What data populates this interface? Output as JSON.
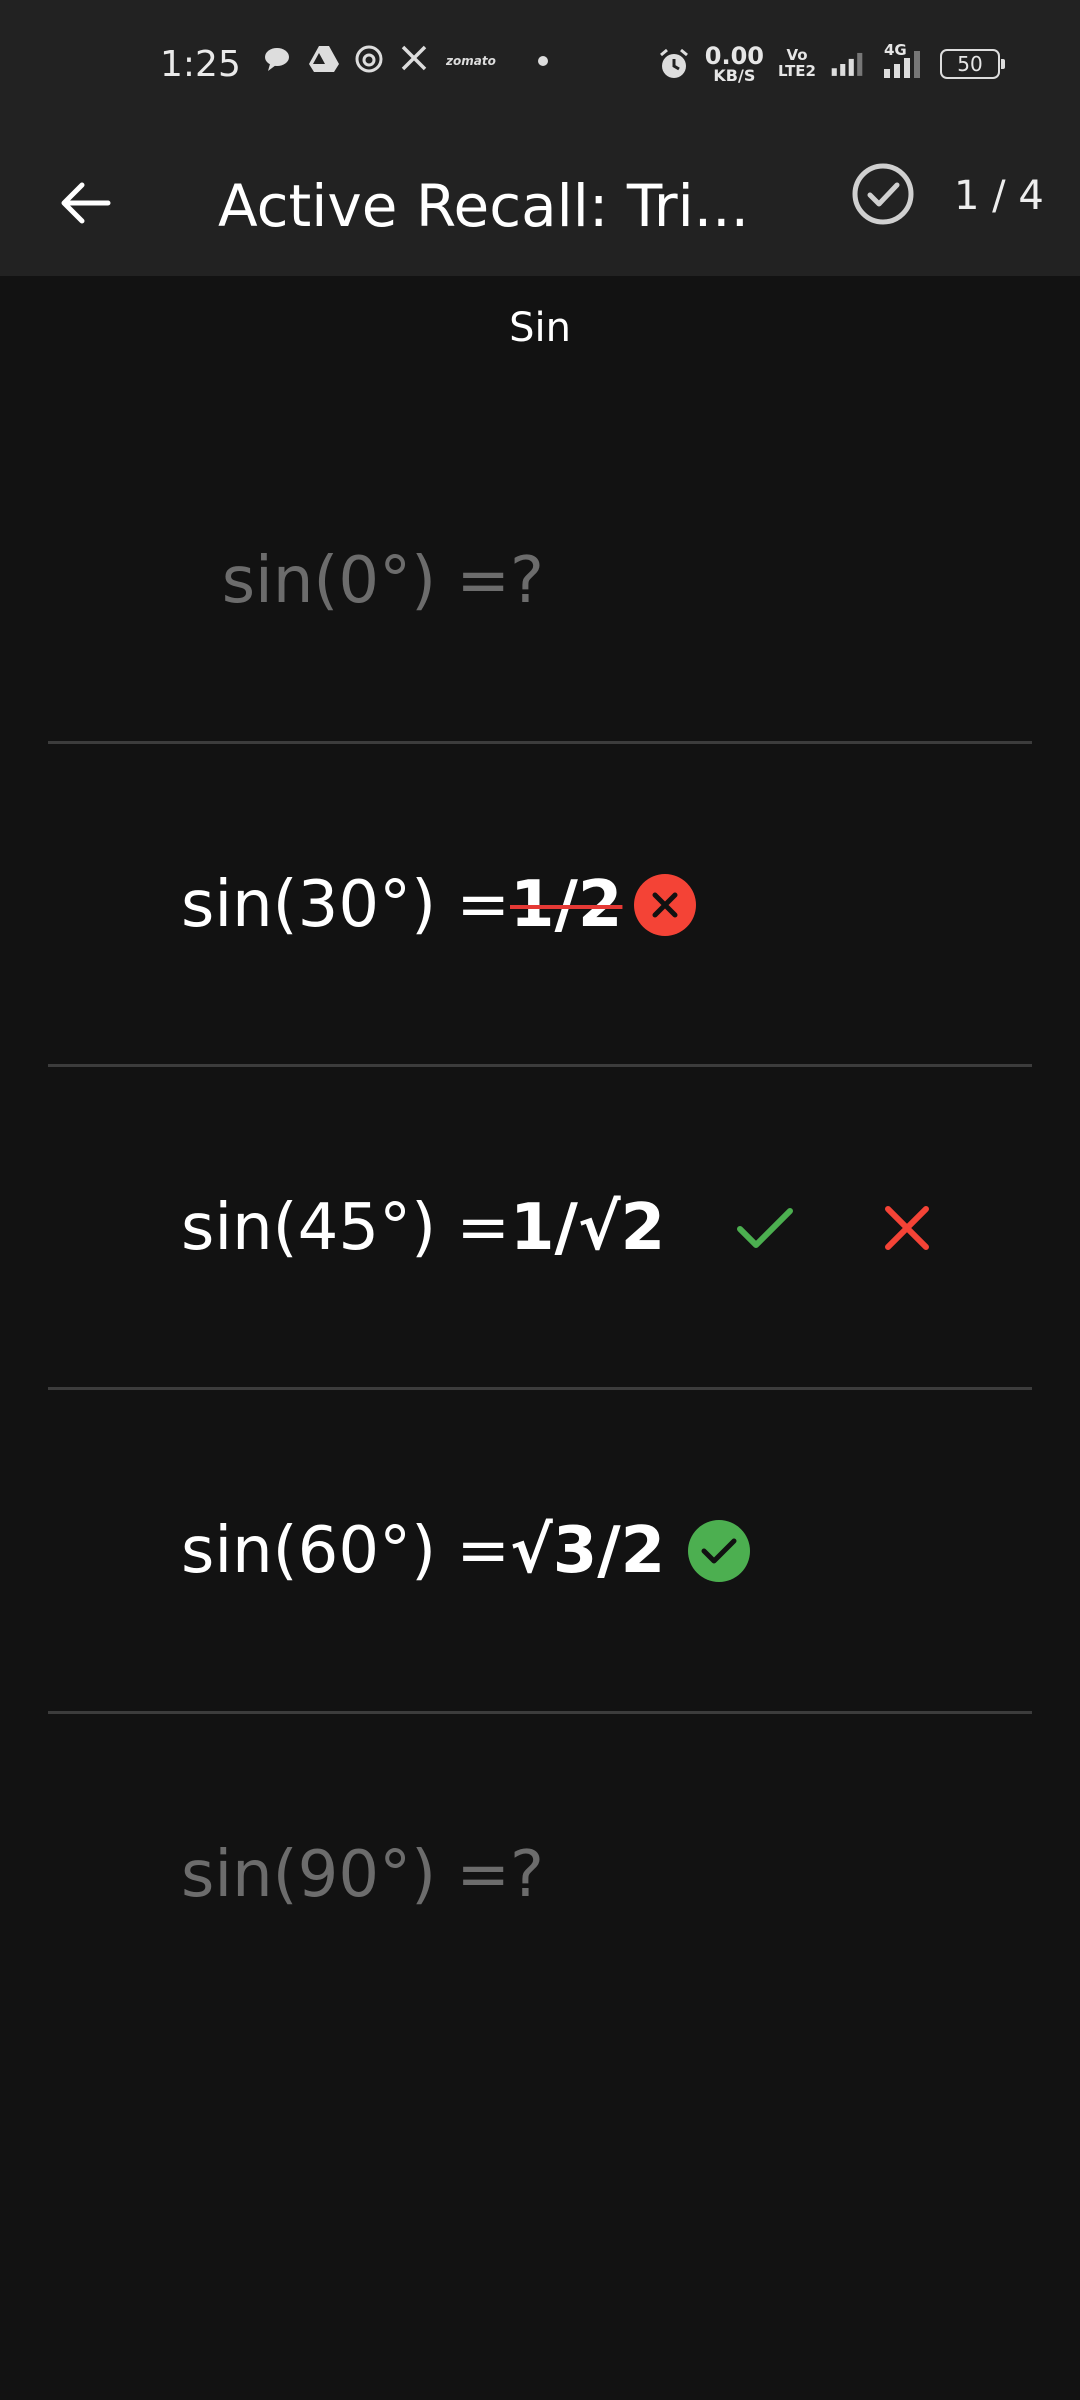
{
  "status_bar": {
    "time": "1:25",
    "net_speed_value": "0.00",
    "net_speed_unit": "KB/S",
    "volte_line1": "Vo",
    "volte_line2": "LTE2",
    "network": "4G",
    "battery": "50",
    "app_icons": [
      "chat-bubble-icon",
      "drive-icon",
      "threads-icon",
      "x-icon",
      "zomato-icon"
    ],
    "zomato_label": "zomato"
  },
  "app_bar": {
    "title": "Active Recall: Tri...",
    "counter": "1 / 4"
  },
  "section_title": "Sin",
  "rows": [
    {
      "question": "sin(0°) =",
      "answer": "?",
      "state": "hidden"
    },
    {
      "question": "sin(30°) =",
      "answer": "1/2",
      "state": "incorrect"
    },
    {
      "question": "sin(45°) =",
      "answer": "1/√2",
      "state": "pending"
    },
    {
      "question": "sin(60°) =",
      "answer": "√3/2",
      "state": "correct"
    },
    {
      "question": "sin(90°) =",
      "answer": "?",
      "state": "hidden"
    }
  ],
  "colors": {
    "background": "#121212",
    "bar": "#222222",
    "correct": "#4caf50",
    "incorrect": "#f44336",
    "dim_text": "#6c6c6c"
  }
}
